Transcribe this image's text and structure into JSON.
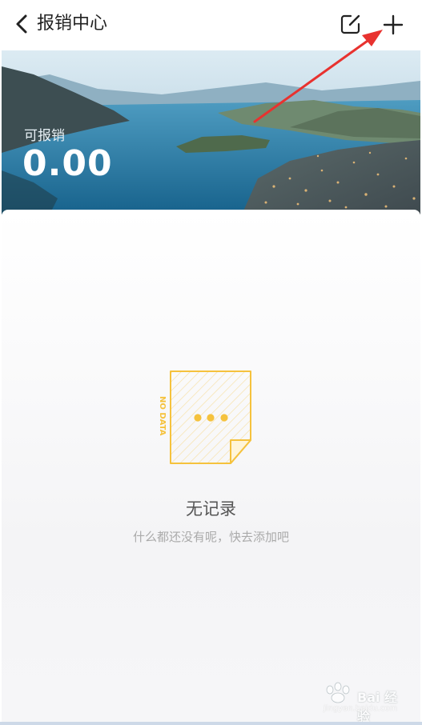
{
  "header": {
    "title": "报销中心",
    "back_icon": "chevron-left-icon",
    "edit_icon": "edit-icon",
    "add_icon": "plus-icon"
  },
  "banner": {
    "balance_label": "可报销",
    "balance_value": "0.00"
  },
  "empty_state": {
    "illustration_text": "NO DATA",
    "title": "无记录",
    "subtitle": "什么都还没有呢，快去添加吧"
  },
  "watermark": {
    "brand": "Bai 经验",
    "url": "jingyan.baidu.com"
  },
  "colors": {
    "accent_yellow": "#f5c23d",
    "arrow_red": "#e8322f",
    "sky_top": "#cfe3ef",
    "lake": "#2a7aa3"
  }
}
